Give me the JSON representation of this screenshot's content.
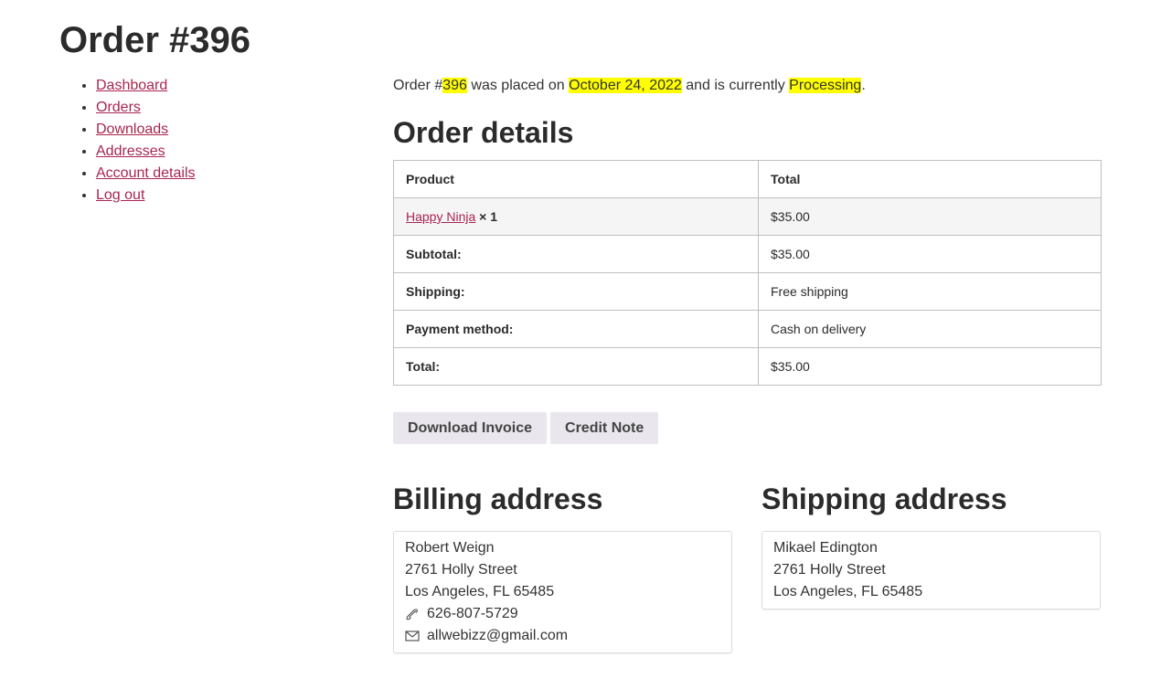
{
  "page": {
    "title": "Order #396"
  },
  "nav": {
    "items": [
      {
        "label": "Dashboard"
      },
      {
        "label": "Orders"
      },
      {
        "label": "Downloads"
      },
      {
        "label": "Addresses"
      },
      {
        "label": "Account details"
      },
      {
        "label": "Log out"
      }
    ]
  },
  "summary": {
    "prefix": "Order #",
    "order_number": "396",
    "mid1": " was placed on ",
    "date": "October 24, 2022",
    "mid2": " and is currently ",
    "status": "Processing",
    "suffix": "."
  },
  "order_details": {
    "title": "Order details",
    "header": {
      "product": "Product",
      "total": "Total"
    },
    "item": {
      "name": "Happy Ninja",
      "qty": "× 1",
      "total": "$35.00"
    },
    "rows": [
      {
        "label": "Subtotal:",
        "value": "$35.00"
      },
      {
        "label": "Shipping:",
        "value": "Free shipping"
      },
      {
        "label": "Payment method:",
        "value": "Cash on delivery"
      },
      {
        "label": "Total:",
        "value": "$35.00"
      }
    ]
  },
  "actions": {
    "download_invoice": "Download Invoice",
    "credit_note": "Credit Note"
  },
  "billing": {
    "title": "Billing address",
    "name": "Robert Weign",
    "street": "2761 Holly Street",
    "city": "Los Angeles, FL 65485",
    "phone": "626-807-5729",
    "email": "allwebizz@gmail.com",
    "phone_icon": "phone-icon",
    "email_icon": "envelope-icon"
  },
  "shipping": {
    "title": "Shipping address",
    "name": "Mikael Edington",
    "street": "2761 Holly Street",
    "city": "Los Angeles, FL 65485"
  },
  "colors": {
    "link": "#a8264f",
    "highlight": "#ffff00",
    "button_bg": "#e9e6ed"
  }
}
